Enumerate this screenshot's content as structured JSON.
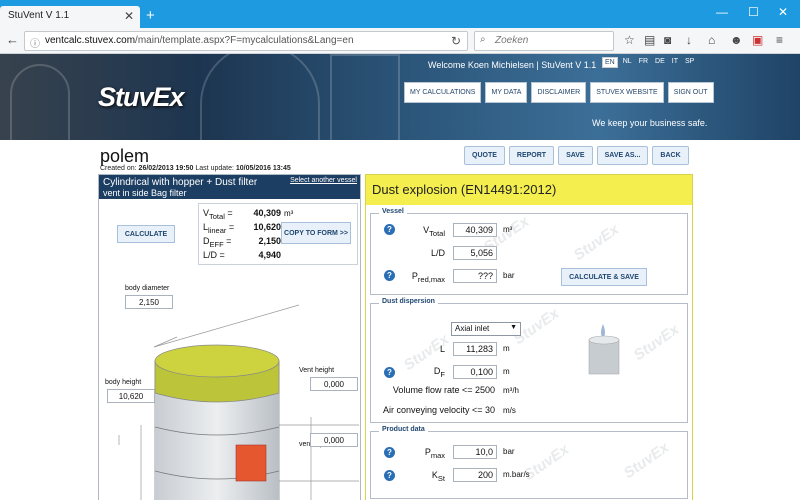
{
  "browser": {
    "tab_title": "StuVent V 1.1",
    "url_domain": "ventcalc.stuvex.com",
    "url_path": "/main/template.aspx?F=mycalculations&Lang=en",
    "search_placeholder": "Zoeken"
  },
  "header": {
    "logo": "StuvEx",
    "welcome": "Welcome Koen Michielsen | StuVent V 1.1",
    "languages": [
      "EN",
      "NL",
      "FR",
      "DE",
      "IT",
      "SP"
    ],
    "active_language": "EN",
    "nav": [
      "MY CALCULATIONS",
      "MY DATA",
      "DISCLAIMER",
      "STUVEX WEBSITE",
      "SIGN OUT"
    ],
    "slogan": "We keep your business safe."
  },
  "page": {
    "title": "polem",
    "created_label": "Created on:",
    "created_value": "26/02/2013 19:50",
    "update_label": "Last update:",
    "update_value": "10/05/2016 13:45",
    "actions": [
      "QUOTE",
      "REPORT",
      "SAVE",
      "SAVE AS...",
      "BACK"
    ]
  },
  "left_panel": {
    "title": "Cylindrical with hopper + Dust filter",
    "subtitle": "vent in side Bag filter",
    "select_link": "Select another vessel",
    "calculate_button": "CALCULATE",
    "copy_button": "COPY TO FORM >>",
    "results": [
      {
        "label": "V",
        "sub": "Total",
        "value": "40,309",
        "unit": "m³"
      },
      {
        "label": "L",
        "sub": "linear",
        "value": "10,620",
        "unit": "m"
      },
      {
        "label": "D",
        "sub": "EFF",
        "value": "2,150",
        "unit": "m"
      },
      {
        "label": "L/D",
        "sub": "",
        "value": "4,940",
        "unit": ""
      }
    ],
    "body_diameter_label": "body diameter",
    "body_diameter_value": "2,150",
    "body_height_label": "body height",
    "body_height_value": "10,620",
    "vent_height_label": "Vent height",
    "vent_height_value": "0,000",
    "vent_top_label": "vent top",
    "vent_top_value": "0,000"
  },
  "right_panel": {
    "title": "Dust explosion (EN14491:2012)",
    "watermark": "StuvEx",
    "vessel": {
      "legend": "Vessel",
      "v_label": "V",
      "v_sub": "Total",
      "v_value": "40,309",
      "v_unit": "m³",
      "ld_label": "L/D",
      "ld_value": "5,056",
      "pred_label": "P",
      "pred_sub": "red,max",
      "pred_value": "???",
      "pred_unit": "bar",
      "calc_save_button": "CALCULATE & SAVE"
    },
    "dispersion": {
      "legend": "Dust dispersion",
      "select_value": "Axial inlet",
      "l_label": "L",
      "l_value": "11,283",
      "l_unit": "m",
      "df_label": "D",
      "df_sub": "F",
      "df_value": "0,100",
      "df_unit": "m",
      "flow_label": "Volume flow rate <= 2500",
      "flow_unit": "m³/h",
      "air_label": "Air conveying velocity <= 30",
      "air_unit": "m/s"
    },
    "product": {
      "legend": "Product data",
      "pmax_label": "P",
      "pmax_sub": "max",
      "pmax_value": "10,0",
      "pmax_unit": "bar",
      "kst_label": "K",
      "kst_sub": "St",
      "kst_value": "200",
      "kst_unit": "m.bar/s"
    }
  }
}
